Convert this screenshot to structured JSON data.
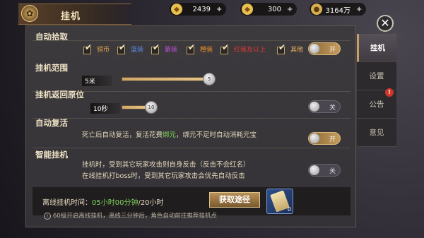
{
  "window": {
    "title": "挂机"
  },
  "resources": [
    {
      "icon": "gold-ingot-icon",
      "value": "2439",
      "plus": "+"
    },
    {
      "icon": "silver-ingot-icon",
      "value": "300",
      "plus": "+"
    },
    {
      "icon": "copper-coin-icon",
      "value": "3164万",
      "plus": "+"
    }
  ],
  "close": {
    "label": "✕"
  },
  "auto_pickup": {
    "title": "自动拾取",
    "options": [
      {
        "label": "铜币",
        "color": "#e0a44a",
        "checked": true
      },
      {
        "label": "蓝装",
        "color": "#5a8ae8",
        "checked": true
      },
      {
        "label": "紫装",
        "color": "#b850d0",
        "checked": true
      },
      {
        "label": "橙装",
        "color": "#f0902a",
        "checked": true
      },
      {
        "label": "红装及以上",
        "color": "#e03838",
        "checked": true
      },
      {
        "label": "其他",
        "color": "#f0b060",
        "checked": true
      }
    ],
    "toggle": {
      "state": "on",
      "label": "开"
    }
  },
  "range": {
    "title": "挂机范围",
    "value_text": "5米",
    "value": 5,
    "min": 0,
    "max": 5,
    "thumb_label": "5"
  },
  "return_pos": {
    "title": "挂机返回原位",
    "value_text": "10秒",
    "value": 10,
    "thumb_label": "10",
    "toggle": {
      "state": "off",
      "label": "关"
    }
  },
  "auto_revive": {
    "title": "自动复活",
    "desc_prefix": "死亡后自动复活，复活花费",
    "desc_green": "绑元",
    "desc_suffix": "，绑元不足时自动消耗元宝",
    "toggle": {
      "state": "on",
      "label": "开"
    }
  },
  "smart": {
    "title": "智能挂机",
    "desc1": "挂机时，受到其它玩家攻击则自身反击（反击不会红名）",
    "desc2": "在线挂机打boss时，受到其它玩家攻击会优先自动反击",
    "toggle": {
      "state": "off",
      "label": "关"
    }
  },
  "offline": {
    "label": "离线挂机时间：",
    "time": "05小时00分钟",
    "max": "/20小时",
    "button": "获取途径",
    "item_count": "0",
    "note_icon": "!",
    "note": "60级开启离线挂机，离线三分钟后，角色自动前往推荐挂机点"
  },
  "tabs": [
    {
      "label": "挂机",
      "active": true
    },
    {
      "label": "设置",
      "active": false
    },
    {
      "label": "公告",
      "active": false,
      "badge": "!"
    },
    {
      "label": "意见",
      "active": false
    }
  ]
}
